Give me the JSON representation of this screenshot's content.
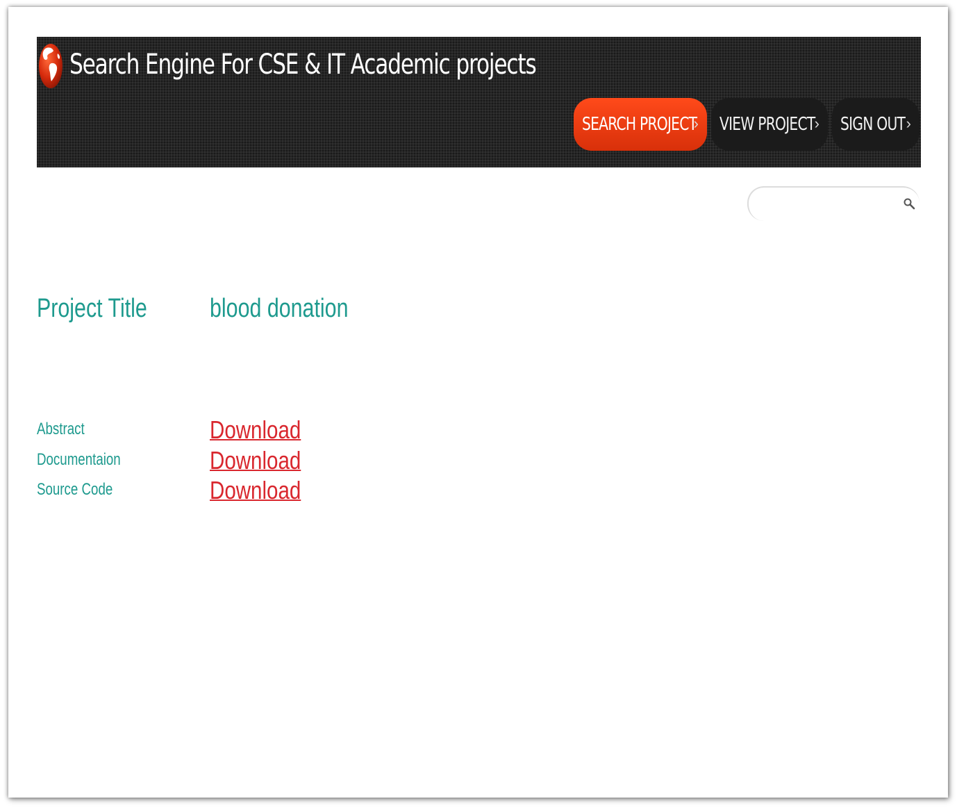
{
  "header": {
    "site_title": "Search Engine For CSE & IT Academic projects",
    "logo_icon": "globe-icon",
    "nav": [
      {
        "label": "SEARCH PROJECT",
        "arrow": "›",
        "active": true
      },
      {
        "label": "VIEW PROJECT",
        "arrow": "›",
        "active": false
      },
      {
        "label": "SIGN OUT",
        "arrow": "›",
        "active": false
      }
    ]
  },
  "search": {
    "placeholder": "",
    "value": "",
    "icon": "search-icon"
  },
  "project": {
    "title_label": "Project Title",
    "title_value": "blood donation",
    "files": [
      {
        "label": "Abstract",
        "link": "Download"
      },
      {
        "label": "Documentaion",
        "link": "Download"
      },
      {
        "label": "Source Code",
        "link": "Download"
      }
    ]
  },
  "colors": {
    "header_bg": "#262626",
    "active_nav": "#e8380e",
    "accent_teal": "#1e9a8e",
    "link_red": "#d9272e"
  }
}
